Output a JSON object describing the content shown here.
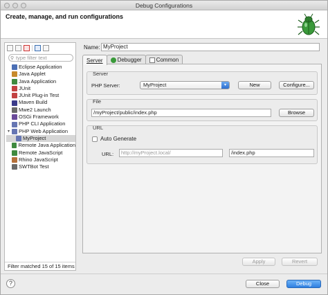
{
  "window": {
    "title": "Debug Configurations"
  },
  "header": {
    "title": "Create, manage, and run configurations"
  },
  "left": {
    "filter_placeholder": "type filter text",
    "tree": [
      {
        "label": "Eclipse Application",
        "color": "#4b6fb5",
        "level": 1
      },
      {
        "label": "Java Applet",
        "color": "#c78a2c",
        "level": 1
      },
      {
        "label": "Java Application",
        "color": "#3f8a3f",
        "level": 1
      },
      {
        "label": "JUnit",
        "color": "#c24141",
        "level": 1,
        "glyph": "Ju"
      },
      {
        "label": "JUnit Plug-in Test",
        "color": "#c24141",
        "level": 1
      },
      {
        "label": "Maven Build",
        "color": "#3a3a8a",
        "level": 1
      },
      {
        "label": "Mwe2 Launch",
        "color": "#6a6a6a",
        "level": 1
      },
      {
        "label": "OSGi Framework",
        "color": "#6a4a9a",
        "level": 1
      },
      {
        "label": "PHP CLI Application",
        "color": "#6676b3",
        "level": 1
      },
      {
        "label": "PHP Web Application",
        "color": "#6676b3",
        "level": 1,
        "expanded": true
      },
      {
        "label": "MyProject",
        "color": "#6676b3",
        "level": 2,
        "selected": true
      },
      {
        "label": "Remote Java Application",
        "color": "#3f8a3f",
        "level": 1
      },
      {
        "label": "Remote JavaScript",
        "color": "#3f8a3f",
        "level": 1
      },
      {
        "label": "Rhino JavaScript",
        "color": "#b5703a",
        "level": 1
      },
      {
        "label": "SWTBot Test",
        "color": "#6a6a6a",
        "level": 1
      }
    ],
    "status": "Filter matched 15 of 15 items"
  },
  "right": {
    "name_label": "Name:",
    "name_value": "MyProject",
    "tabs": [
      {
        "label": "Server",
        "active": true
      },
      {
        "label": "Debugger",
        "active": false
      },
      {
        "label": "Common",
        "active": false
      }
    ],
    "server_group": {
      "label": "Server",
      "php_server_label": "PHP Server:",
      "php_server_value": "MyProject",
      "new_label": "New",
      "configure_label": "Configure..."
    },
    "file_group": {
      "label": "File",
      "path": "/myProject/public/index.php",
      "browse_label": "Browse"
    },
    "url_group": {
      "label": "URL",
      "auto_generate_label": "Auto Generate",
      "url_label": "URL:",
      "url_base": "http://myProject.local/",
      "url_path": "/index.php"
    },
    "apply_label": "Apply",
    "revert_label": "Revert"
  },
  "footer": {
    "close_label": "Close",
    "debug_label": "Debug"
  },
  "colors": {
    "accent": "#2e7fe0",
    "bug_green": "#3a9a3a"
  }
}
